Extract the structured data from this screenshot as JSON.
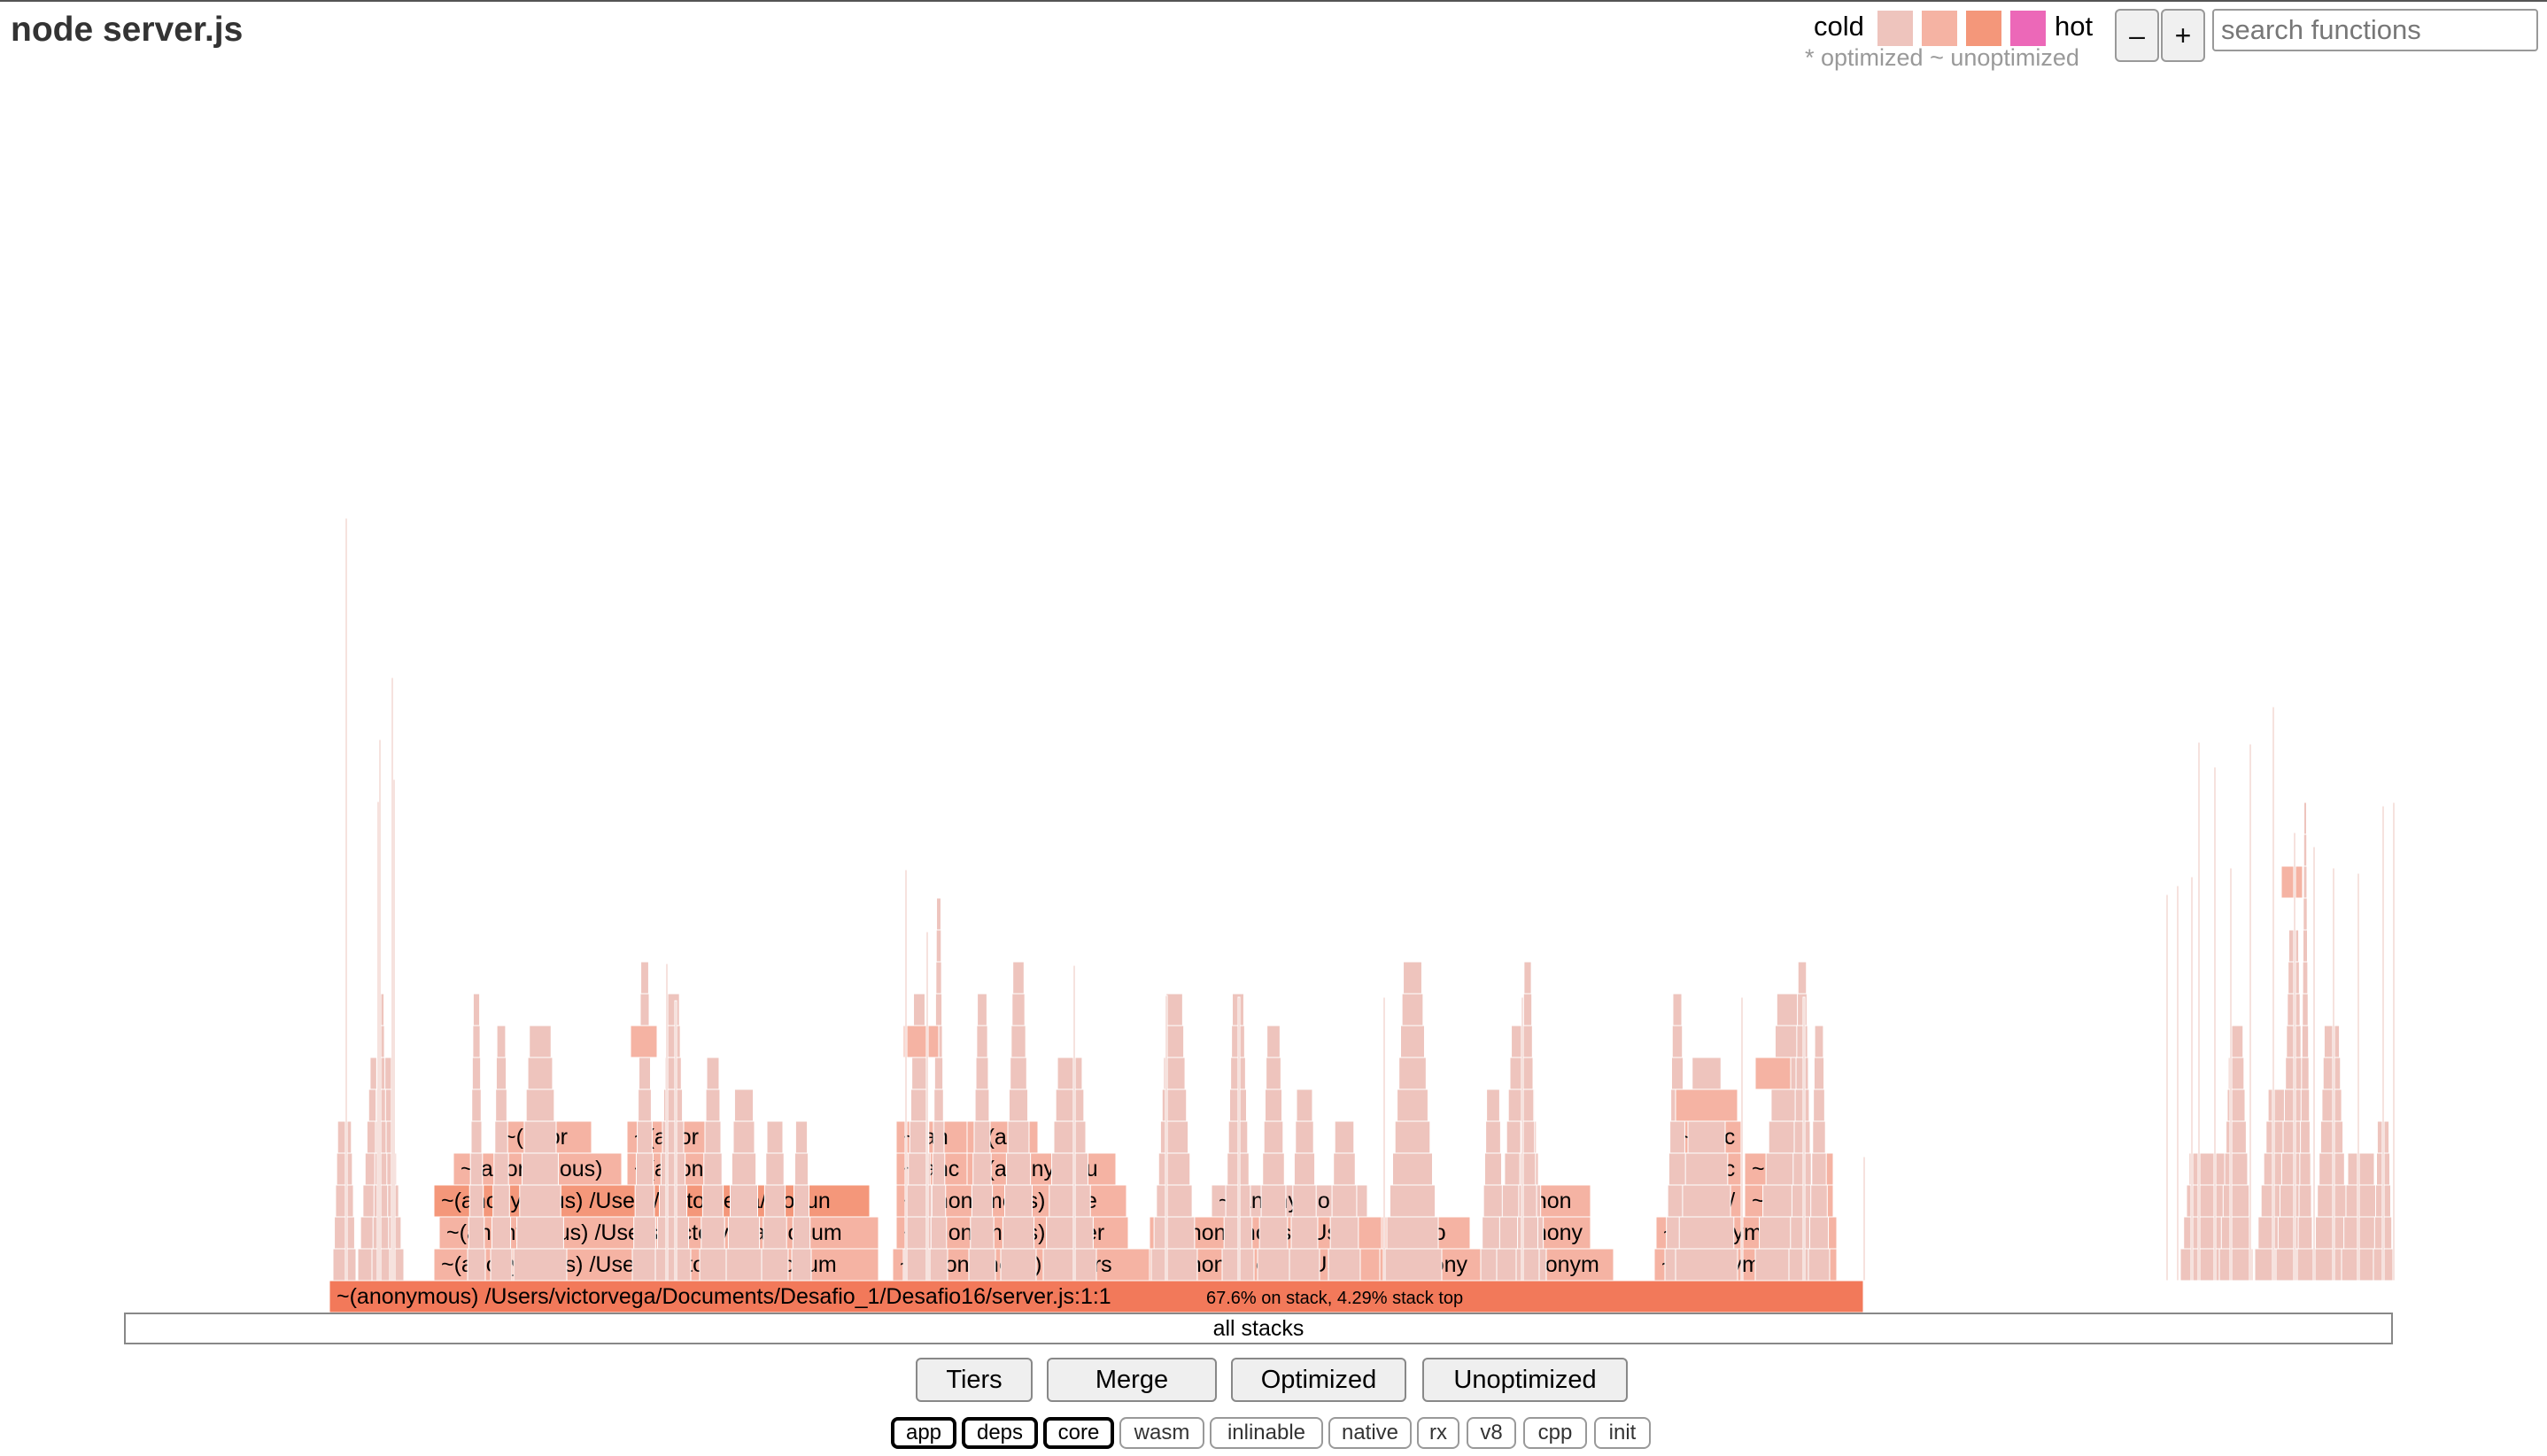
{
  "title": "node server.js",
  "legend": {
    "cold": "cold",
    "hot": "hot",
    "subtitle": "* optimized ~ unoptimized",
    "swatches": [
      "#eec4bd",
      "#f5b3a3",
      "#f4977a",
      "#ec68b8"
    ]
  },
  "zoom": {
    "out": "–",
    "in": "+"
  },
  "search": {
    "placeholder": "search functions"
  },
  "flamegraph": {
    "root_label": "~(anonymous) /Users/victorvega/Documents/Desafio_1/Desafio16/server.js:1:1",
    "root_stats": "67.6% on stack, 4.29% stack top",
    "all_stacks": "all stacks",
    "frame_labels": [
      "~(anonymous) /Users/victorvega/Docum",
      "~(anonymous) /Users/victorvega/Docum",
      "~(anonymous) /Users/victorvega/Docun",
      "~(anonymous)",
      "~(anor",
      "~(anony",
      "~(anor",
      "~(anonymous) /Users",
      "~(anonymous) /User",
      "~(anonymous) /Use",
      "~(anc",
      "~(anonymou",
      "~(an",
      "~(anc",
      "~(anonymous) /User",
      "~(anonymous) /User",
      "~(anonymo",
      "~(anony",
      "~(ano",
      "~(anonym",
      "~(anony",
      "~(anon",
      "~(anonymous) /",
      "~(anonymous) /",
      "~get /",
      "~(anon",
      "~(anc",
      "~(ano",
      "~(anc"
    ]
  },
  "controls": {
    "buttons": [
      "Tiers",
      "Merge",
      "Optimized",
      "Unoptimized"
    ],
    "filters": [
      {
        "label": "app",
        "active": true
      },
      {
        "label": "deps",
        "active": true
      },
      {
        "label": "core",
        "active": true
      },
      {
        "label": "wasm",
        "active": false
      },
      {
        "label": "inlinable",
        "active": false
      },
      {
        "label": "native",
        "active": false
      },
      {
        "label": "rx",
        "active": false
      },
      {
        "label": "v8",
        "active": false
      },
      {
        "label": "cpp",
        "active": false
      },
      {
        "label": "init",
        "active": false
      }
    ]
  },
  "colors": {
    "root": "#f2795a",
    "hot_frame": "#f4977a",
    "warm_frame": "#f5b3a3",
    "cold_frame": "#eec4bd"
  }
}
